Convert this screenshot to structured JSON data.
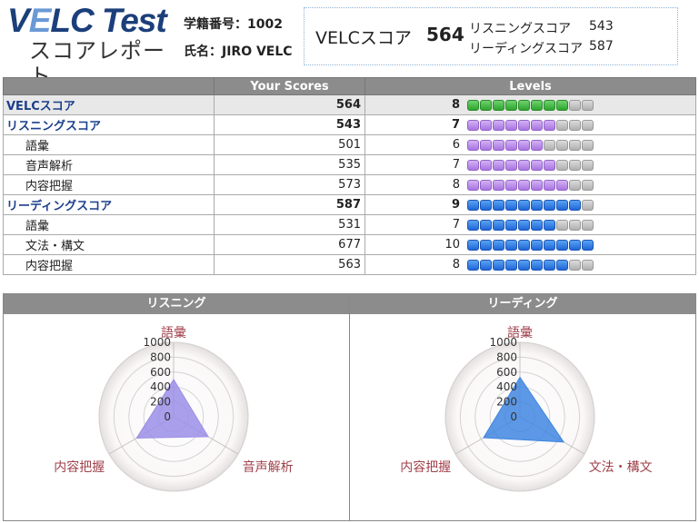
{
  "header": {
    "logo_main_a": "V",
    "logo_main_e": "E",
    "logo_main_b": "LC Test",
    "logo_sub": "スコアレポート",
    "student_id_label": "学籍番号：",
    "student_id": "1002",
    "name_label": "氏名：",
    "name": "JIRO VELC"
  },
  "summary": {
    "main_label": "VELCスコア",
    "main_value": "564",
    "listening_label": "リスニングスコア",
    "listening_value": "543",
    "reading_label": "リーディングスコア",
    "reading_value": "587"
  },
  "table": {
    "col_scores": "Your Scores",
    "col_levels": "Levels",
    "max_level": 10,
    "rows": [
      {
        "name": "VELCスコア",
        "score": "564",
        "level": "8",
        "color": "green",
        "kind": "main",
        "highlight": true
      },
      {
        "name": "リスニングスコア",
        "score": "543",
        "level": "7",
        "color": "purple",
        "kind": "main",
        "highlight": false
      },
      {
        "name": "語彙",
        "score": "501",
        "level": "6",
        "color": "purple",
        "kind": "sub",
        "highlight": false
      },
      {
        "name": "音声解析",
        "score": "535",
        "level": "7",
        "color": "purple",
        "kind": "sub",
        "highlight": false
      },
      {
        "name": "内容把握",
        "score": "573",
        "level": "8",
        "color": "purple",
        "kind": "sub",
        "highlight": false
      },
      {
        "name": "リーディングスコア",
        "score": "587",
        "level": "9",
        "color": "blue",
        "kind": "main",
        "highlight": false
      },
      {
        "name": "語彙",
        "score": "531",
        "level": "7",
        "color": "blue",
        "kind": "sub",
        "highlight": false
      },
      {
        "name": "文法・構文",
        "score": "677",
        "level": "10",
        "color": "blue",
        "kind": "sub",
        "highlight": false
      },
      {
        "name": "内容把握",
        "score": "563",
        "level": "8",
        "color": "blue",
        "kind": "sub",
        "highlight": false
      }
    ]
  },
  "colors": {
    "green": "#3cb43c",
    "purple": "#b88ae8",
    "blue": "#2e7ae0",
    "gray": "#c4c4c4",
    "listening_fill": "#9b8ee8",
    "reading_fill": "#3f86e0"
  },
  "chart_data": [
    {
      "type": "radar",
      "title": "リスニング",
      "axes": [
        "語彙",
        "音声解析",
        "内容把握"
      ],
      "values": [
        501,
        535,
        573
      ],
      "rmax": 1000,
      "ticks": [
        "0",
        "200",
        "400",
        "600",
        "800",
        "1000"
      ]
    },
    {
      "type": "radar",
      "title": "リーディング",
      "axes": [
        "語彙",
        "文法・構文",
        "内容把握"
      ],
      "values": [
        531,
        677,
        563
      ],
      "rmax": 1000,
      "ticks": [
        "0",
        "200",
        "400",
        "600",
        "800",
        "1000"
      ]
    }
  ]
}
